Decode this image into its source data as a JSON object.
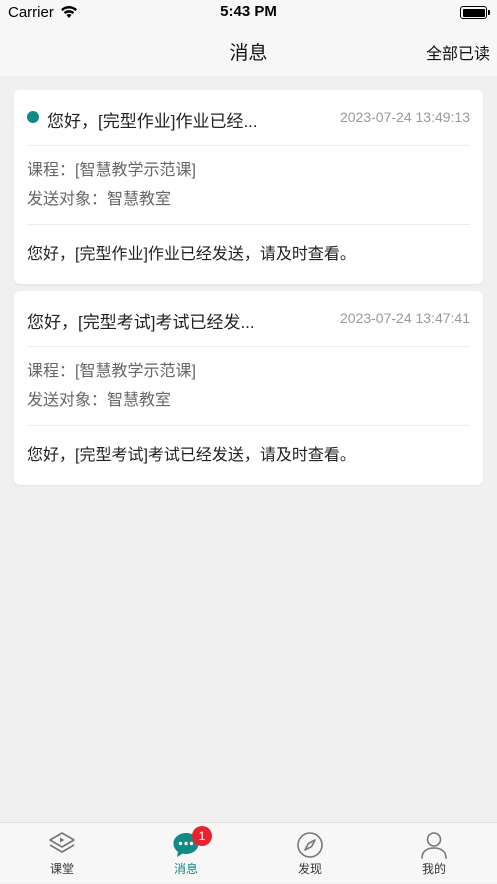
{
  "status_bar": {
    "carrier": "Carrier",
    "time": "5:43 PM"
  },
  "nav": {
    "title": "消息",
    "mark_all_read": "全部已读"
  },
  "messages": [
    {
      "title": "您好，[完型作业]作业已经...",
      "time": "2023-07-24 13:49:13",
      "course": "课程：[智慧教学示范课]",
      "target": "发送对象：智慧教室",
      "body": "您好，[完型作业]作业已经发送，请及时查看。",
      "unread": true
    },
    {
      "title": "您好，[完型考试]考试已经发...",
      "time": "2023-07-24 13:47:41",
      "course": "课程：[智慧教学示范课]",
      "target": "发送对象：智慧教室",
      "body": "您好，[完型考试]考试已经发送，请及时查看。",
      "unread": false
    }
  ],
  "tabbar": {
    "items": [
      {
        "label": "课堂",
        "icon": "classroom-icon"
      },
      {
        "label": "消息",
        "icon": "message-icon",
        "badge": "1",
        "active": true
      },
      {
        "label": "发现",
        "icon": "compass-icon"
      },
      {
        "label": "我的",
        "icon": "profile-icon"
      }
    ]
  },
  "colors": {
    "accent": "#0f8a84",
    "badge": "#e8232d",
    "background": "#f0f0f0"
  }
}
